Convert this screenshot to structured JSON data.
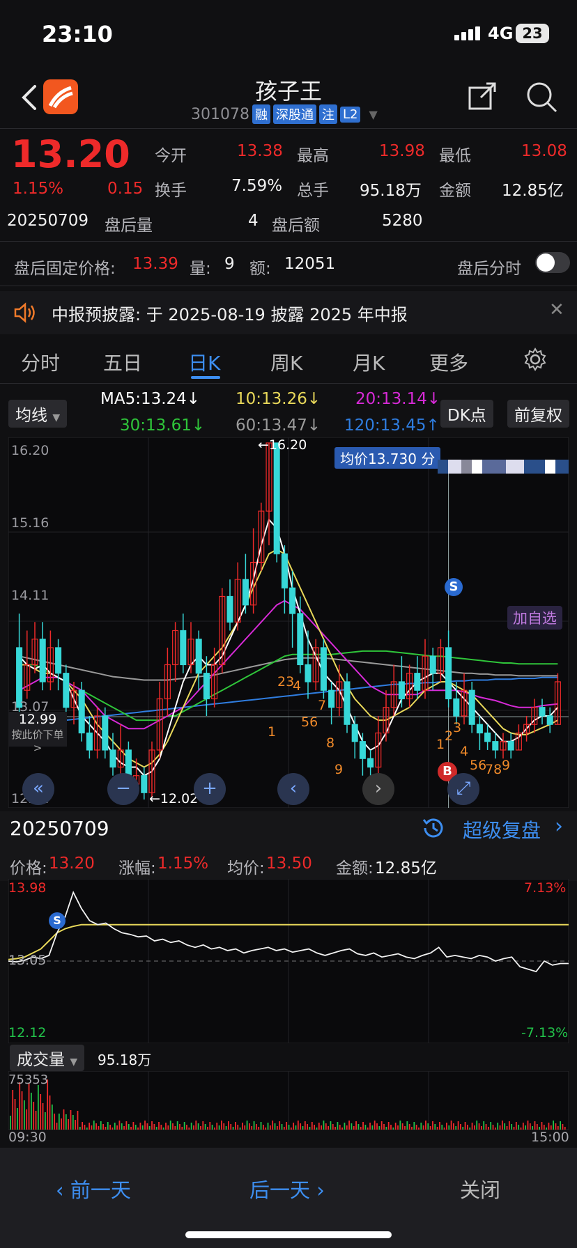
{
  "status_bar": {
    "time": "23:10",
    "network": "4G",
    "battery": "23"
  },
  "header": {
    "title": "孩子王",
    "code": "301078",
    "tags": [
      "融",
      "深股通",
      "注",
      "L2"
    ]
  },
  "quote": {
    "price": "13.20",
    "change_pct": "1.15%",
    "change": "0.15",
    "open_label": "今开",
    "open": "13.38",
    "high_label": "最高",
    "high": "13.98",
    "low_label": "最低",
    "low": "13.08",
    "turnover_label": "换手",
    "turnover": "7.59%",
    "total_vol_label": "总手",
    "total_vol": "95.18万",
    "amount_label": "金额",
    "amount": "12.85亿",
    "date": "20250709",
    "after_vol_label": "盘后量",
    "after_vol": "4",
    "after_amt_label": "盘后额",
    "after_amt": "5280"
  },
  "after_hours": {
    "fixed_price_label": "盘后固定价格:",
    "fixed_price": "13.39",
    "vol_label": "量:",
    "vol": "9",
    "amt_label": "额:",
    "amt": "12051",
    "toggle_label": "盘后分时",
    "toggle_on": false
  },
  "notice": {
    "text": "中报预披露:  于 2025-08-19 披露 2025 年中报"
  },
  "tabs": [
    "分时",
    "五日",
    "日K",
    "周K",
    "月K",
    "更多"
  ],
  "active_tab": "日K",
  "ma": {
    "selector": "均线",
    "ma5": "MA5:13.24↓",
    "ma10": "10:13.26↓",
    "ma20": "20:13.14↓",
    "ma30": "30:13.61↓",
    "ma60": "60:13.47↓",
    "ma120": "120:13.45↑",
    "dk_button": "DK点",
    "fq_button": "前复权",
    "colors": {
      "ma5": "#ffffff",
      "ma10": "#e8d85a",
      "ma20": "#d72ad7",
      "ma30": "#2fc53a",
      "ma60": "#9a9a9a",
      "ma120": "#2f7de0"
    }
  },
  "kchart": {
    "y_ticks": [
      "16.20",
      "15.16",
      "14.11",
      "13.07",
      "12.02"
    ],
    "max_label": "←16.20",
    "min_label": "←12.02",
    "avg_label": "均价13.730 分",
    "cursor_price": "12.99",
    "cursor_hint": "按此价下单>",
    "add_watch": "加自选",
    "signal_s": "S",
    "signal_b": "B",
    "count_labels": [
      "23",
      "4",
      "56",
      "7",
      "8",
      "9",
      "1",
      "1",
      "2",
      "3",
      "4",
      "56",
      "78",
      "9"
    ]
  },
  "chart_data": {
    "type": "candlestick",
    "ylim": [
      12.02,
      16.2
    ],
    "candles": [
      [
        13.8,
        13.1,
        14.2,
        13.0
      ],
      [
        13.3,
        13.6,
        14.0,
        13.2
      ],
      [
        13.6,
        13.9,
        14.1,
        13.5
      ],
      [
        13.9,
        13.4,
        14.1,
        13.3
      ],
      [
        13.4,
        13.8,
        14.0,
        13.3
      ],
      [
        13.8,
        13.5,
        13.9,
        13.3
      ],
      [
        13.5,
        13.1,
        13.6,
        13.0
      ],
      [
        13.1,
        13.3,
        13.4,
        12.9
      ],
      [
        13.3,
        12.8,
        13.4,
        12.7
      ],
      [
        12.8,
        12.6,
        13.0,
        12.5
      ],
      [
        12.6,
        13.0,
        13.1,
        12.5
      ],
      [
        13.0,
        12.6,
        13.1,
        12.5
      ],
      [
        12.6,
        12.4,
        12.8,
        12.3
      ],
      [
        12.4,
        12.6,
        12.9,
        12.3
      ],
      [
        12.6,
        12.2,
        12.7,
        12.1
      ],
      [
        12.2,
        12.3,
        12.5,
        12.1
      ],
      [
        12.3,
        12.1,
        12.4,
        12.02
      ],
      [
        12.1,
        12.6,
        12.7,
        12.05
      ],
      [
        12.6,
        13.2,
        13.4,
        12.5
      ],
      [
        13.2,
        13.6,
        13.8,
        13.0
      ],
      [
        13.6,
        14.0,
        14.1,
        13.4
      ],
      [
        14.0,
        13.6,
        14.2,
        13.5
      ],
      [
        13.6,
        13.9,
        14.1,
        13.5
      ],
      [
        13.9,
        13.5,
        14.0,
        13.3
      ],
      [
        13.5,
        13.2,
        13.7,
        13.0
      ],
      [
        13.2,
        13.6,
        13.8,
        13.1
      ],
      [
        13.6,
        14.4,
        14.5,
        13.5
      ],
      [
        14.4,
        14.1,
        14.6,
        14.0
      ],
      [
        14.1,
        14.6,
        14.8,
        14.0
      ],
      [
        14.6,
        14.3,
        14.9,
        14.2
      ],
      [
        14.3,
        14.8,
        15.2,
        14.2
      ],
      [
        14.8,
        15.4,
        15.5,
        14.7
      ],
      [
        15.4,
        16.2,
        16.2,
        15.0
      ],
      [
        16.2,
        14.9,
        16.2,
        14.8
      ],
      [
        14.9,
        14.5,
        15.0,
        14.2
      ],
      [
        14.5,
        14.2,
        14.7,
        13.8
      ],
      [
        14.2,
        13.6,
        14.4,
        13.5
      ],
      [
        13.6,
        13.4,
        14.0,
        13.2
      ],
      [
        13.4,
        13.8,
        13.9,
        13.3
      ],
      [
        13.8,
        13.3,
        13.9,
        13.2
      ],
      [
        13.3,
        13.1,
        13.4,
        12.9
      ],
      [
        13.1,
        13.4,
        13.6,
        13.0
      ],
      [
        13.4,
        12.9,
        13.5,
        12.8
      ],
      [
        12.9,
        12.7,
        13.0,
        12.5
      ],
      [
        12.7,
        12.5,
        12.8,
        12.3
      ],
      [
        12.5,
        12.4,
        12.6,
        12.2
      ],
      [
        12.4,
        12.8,
        13.0,
        12.3
      ],
      [
        12.8,
        13.1,
        13.3,
        12.7
      ],
      [
        13.1,
        13.4,
        13.6,
        13.0
      ],
      [
        13.4,
        13.2,
        13.7,
        13.1
      ],
      [
        13.2,
        13.5,
        13.6,
        13.1
      ],
      [
        13.5,
        13.3,
        13.7,
        13.2
      ],
      [
        13.3,
        13.7,
        13.9,
        13.2
      ],
      [
        13.7,
        13.5,
        13.8,
        13.3
      ],
      [
        13.5,
        13.8,
        13.9,
        13.4
      ],
      [
        13.8,
        13.2,
        14.0,
        13.1
      ],
      [
        13.2,
        13.0,
        13.4,
        12.9
      ],
      [
        13.0,
        13.3,
        13.5,
        12.9
      ],
      [
        13.3,
        12.9,
        13.4,
        12.8
      ],
      [
        12.9,
        12.8,
        13.0,
        12.6
      ],
      [
        12.8,
        12.7,
        12.9,
        12.6
      ],
      [
        12.7,
        12.6,
        12.8,
        12.5
      ],
      [
        12.6,
        12.7,
        12.8,
        12.5
      ],
      [
        12.7,
        12.6,
        12.8,
        12.5
      ],
      [
        12.6,
        12.8,
        12.9,
        12.6
      ],
      [
        12.8,
        12.9,
        13.0,
        12.7
      ],
      [
        12.9,
        13.1,
        13.2,
        12.8
      ],
      [
        13.1,
        13.0,
        13.2,
        12.9
      ],
      [
        13.0,
        12.9,
        13.1,
        12.8
      ],
      [
        12.9,
        13.4,
        13.5,
        12.9
      ]
    ],
    "ma5": [
      13.7,
      13.6,
      13.55,
      13.6,
      13.5,
      13.45,
      13.4,
      13.2,
      13.0,
      12.9,
      12.8,
      12.7,
      12.55,
      12.45,
      12.4,
      12.4,
      12.3,
      12.35,
      12.5,
      12.8,
      13.1,
      13.4,
      13.6,
      13.7,
      13.6,
      13.6,
      13.7,
      13.9,
      14.1,
      14.3,
      14.6,
      15.0,
      15.3,
      15.2,
      14.9,
      14.5,
      14.2,
      13.9,
      13.7,
      13.5,
      13.4,
      13.3,
      13.1,
      12.9,
      12.7,
      12.6,
      12.65,
      12.8,
      13.0,
      13.2,
      13.3,
      13.4,
      13.45,
      13.5,
      13.5,
      13.4,
      13.3,
      13.2,
      13.1,
      13.0,
      12.9,
      12.8,
      12.7,
      12.7,
      12.75,
      12.85,
      12.95,
      13.0,
      13.0,
      13.1
    ],
    "ma10": [
      13.6,
      13.6,
      13.55,
      13.5,
      13.5,
      13.45,
      13.4,
      13.3,
      13.2,
      13.05,
      12.9,
      12.8,
      12.7,
      12.6,
      12.5,
      12.45,
      12.4,
      12.45,
      12.55,
      12.7,
      12.9,
      13.1,
      13.3,
      13.5,
      13.6,
      13.7,
      13.8,
      13.95,
      14.1,
      14.3,
      14.5,
      14.7,
      14.9,
      14.95,
      14.9,
      14.7,
      14.5,
      14.3,
      14.1,
      13.9,
      13.7,
      13.5,
      13.35,
      13.2,
      13.1,
      13.0,
      12.95,
      12.95,
      13.0,
      13.05,
      13.1,
      13.2,
      13.3,
      13.35,
      13.4,
      13.4,
      13.35,
      13.3,
      13.25,
      13.15,
      13.05,
      12.95,
      12.85,
      12.8,
      12.78,
      12.78,
      12.82,
      12.86,
      12.9,
      12.95
    ],
    "ma20": [
      13.3,
      13.35,
      13.4,
      13.45,
      13.45,
      13.45,
      13.4,
      13.35,
      13.3,
      13.2,
      13.1,
      13.0,
      12.95,
      12.9,
      12.85,
      12.85,
      12.85,
      12.9,
      12.95,
      13.0,
      13.05,
      13.1,
      13.2,
      13.3,
      13.4,
      13.5,
      13.6,
      13.7,
      13.8,
      13.9,
      14.0,
      14.1,
      14.2,
      14.3,
      14.35,
      14.3,
      14.25,
      14.15,
      14.05,
      13.95,
      13.85,
      13.75,
      13.65,
      13.55,
      13.45,
      13.35,
      13.3,
      13.25,
      13.25,
      13.25,
      13.25,
      13.25,
      13.3,
      13.3,
      13.3,
      13.3,
      13.3,
      13.28,
      13.25,
      13.22,
      13.2,
      13.18,
      13.15,
      13.12,
      13.1,
      13.1,
      13.1,
      13.12,
      13.13,
      13.14
    ],
    "ma30": [
      13.6,
      13.6,
      13.6,
      13.55,
      13.5,
      13.45,
      13.4,
      13.35,
      13.3,
      13.25,
      13.2,
      13.15,
      13.1,
      13.05,
      13.0,
      12.95,
      12.95,
      12.95,
      12.95,
      13.0,
      13.0,
      13.05,
      13.1,
      13.15,
      13.2,
      13.25,
      13.3,
      13.35,
      13.4,
      13.45,
      13.5,
      13.55,
      13.6,
      13.65,
      13.7,
      13.72,
      13.72,
      13.72,
      13.72,
      13.72,
      13.72,
      13.73,
      13.74,
      13.75,
      13.76,
      13.76,
      13.76,
      13.76,
      13.75,
      13.74,
      13.73,
      13.72,
      13.71,
      13.7,
      13.7,
      13.69,
      13.68,
      13.67,
      13.66,
      13.65,
      13.64,
      13.63,
      13.62,
      13.62,
      13.61,
      13.61,
      13.61,
      13.61,
      13.61,
      13.61
    ],
    "ma60": [
      13.7,
      13.68,
      13.66,
      13.64,
      13.62,
      13.6,
      13.58,
      13.56,
      13.54,
      13.52,
      13.5,
      13.48,
      13.46,
      13.45,
      13.44,
      13.43,
      13.42,
      13.42,
      13.42,
      13.42,
      13.43,
      13.44,
      13.45,
      13.46,
      13.47,
      13.48,
      13.5,
      13.52,
      13.54,
      13.56,
      13.58,
      13.6,
      13.62,
      13.64,
      13.66,
      13.67,
      13.68,
      13.68,
      13.68,
      13.68,
      13.67,
      13.66,
      13.65,
      13.64,
      13.63,
      13.62,
      13.61,
      13.6,
      13.59,
      13.58,
      13.57,
      13.56,
      13.55,
      13.54,
      13.53,
      13.52,
      13.51,
      13.5,
      13.5,
      13.49,
      13.49,
      13.48,
      13.48,
      13.48,
      13.47,
      13.47,
      13.47,
      13.47,
      13.47,
      13.47
    ],
    "ma120": [
      12.9,
      12.9,
      12.91,
      12.92,
      12.93,
      12.94,
      12.95,
      12.96,
      12.97,
      12.98,
      12.99,
      13.0,
      13.01,
      13.02,
      13.03,
      13.04,
      13.05,
      13.06,
      13.07,
      13.08,
      13.09,
      13.1,
      13.11,
      13.12,
      13.13,
      13.14,
      13.15,
      13.16,
      13.17,
      13.18,
      13.19,
      13.2,
      13.21,
      13.22,
      13.23,
      13.24,
      13.25,
      13.26,
      13.27,
      13.28,
      13.29,
      13.3,
      13.31,
      13.32,
      13.33,
      13.34,
      13.35,
      13.36,
      13.37,
      13.37,
      13.38,
      13.38,
      13.39,
      13.39,
      13.4,
      13.4,
      13.41,
      13.41,
      13.42,
      13.42,
      13.42,
      13.43,
      13.43,
      13.43,
      13.44,
      13.44,
      13.44,
      13.45,
      13.45,
      13.45
    ],
    "intraday": {
      "ylim": [
        12.12,
        13.98
      ],
      "price": [
        13.05,
        13.04,
        13.06,
        13.1,
        13.08,
        13.12,
        13.4,
        13.6,
        13.9,
        13.7,
        13.55,
        13.5,
        13.52,
        13.45,
        13.4,
        13.38,
        13.35,
        13.36,
        13.3,
        13.32,
        13.28,
        13.3,
        13.25,
        13.22,
        13.25,
        13.2,
        13.22,
        13.18,
        13.2,
        13.15,
        13.18,
        13.2,
        13.22,
        13.18,
        13.2,
        13.16,
        13.18,
        13.2,
        13.15,
        13.12,
        13.15,
        13.18,
        13.2,
        13.14,
        13.12,
        13.15,
        13.1,
        13.12,
        13.14,
        13.1,
        13.08,
        13.12,
        13.15,
        13.22,
        13.1,
        13.12,
        13.1,
        13.08,
        13.12,
        13.1,
        13.05,
        13.08,
        13.1,
        12.98,
        12.95,
        12.92,
        13.05,
        13.0,
        13.02,
        13.02
      ],
      "avg": [
        13.07,
        13.08,
        13.1,
        13.15,
        13.2,
        13.3,
        13.4,
        13.45,
        13.48,
        13.5,
        13.5,
        13.5,
        13.5,
        13.5,
        13.5,
        13.5,
        13.5,
        13.5,
        13.5,
        13.5,
        13.5,
        13.5,
        13.5,
        13.5,
        13.5,
        13.5,
        13.5,
        13.5,
        13.5,
        13.5,
        13.5,
        13.5,
        13.5,
        13.5,
        13.5,
        13.5,
        13.5,
        13.5,
        13.5,
        13.5,
        13.5,
        13.5,
        13.5,
        13.5,
        13.5,
        13.5,
        13.5,
        13.5,
        13.5,
        13.5,
        13.5,
        13.5,
        13.5,
        13.5,
        13.5,
        13.5,
        13.5,
        13.5,
        13.5,
        13.5,
        13.5,
        13.5,
        13.5,
        13.5,
        13.5,
        13.5,
        13.5,
        13.5,
        13.5,
        13.5
      ]
    }
  },
  "detail": {
    "date": "20250709",
    "replay": "超级复盘",
    "price_label": "价格:",
    "price": "13.20",
    "pct_label": "涨幅:",
    "pct": "1.15%",
    "avg_label": "均价:",
    "avg": "13.50",
    "amt_label": "金额:",
    "amt": "12.85亿",
    "mini_high": "13.98",
    "mini_mid": "13.05",
    "mini_low": "12.12",
    "mini_pct_high": "7.13%",
    "mini_pct_low": "-7.13%",
    "vol_selector": "成交量",
    "vol_total": "95.18万",
    "vol_max": "75353",
    "time_start": "09:30",
    "time_end": "15:00"
  },
  "bottom_nav": {
    "prev": "前一天",
    "next": "后一天",
    "close": "关闭"
  }
}
